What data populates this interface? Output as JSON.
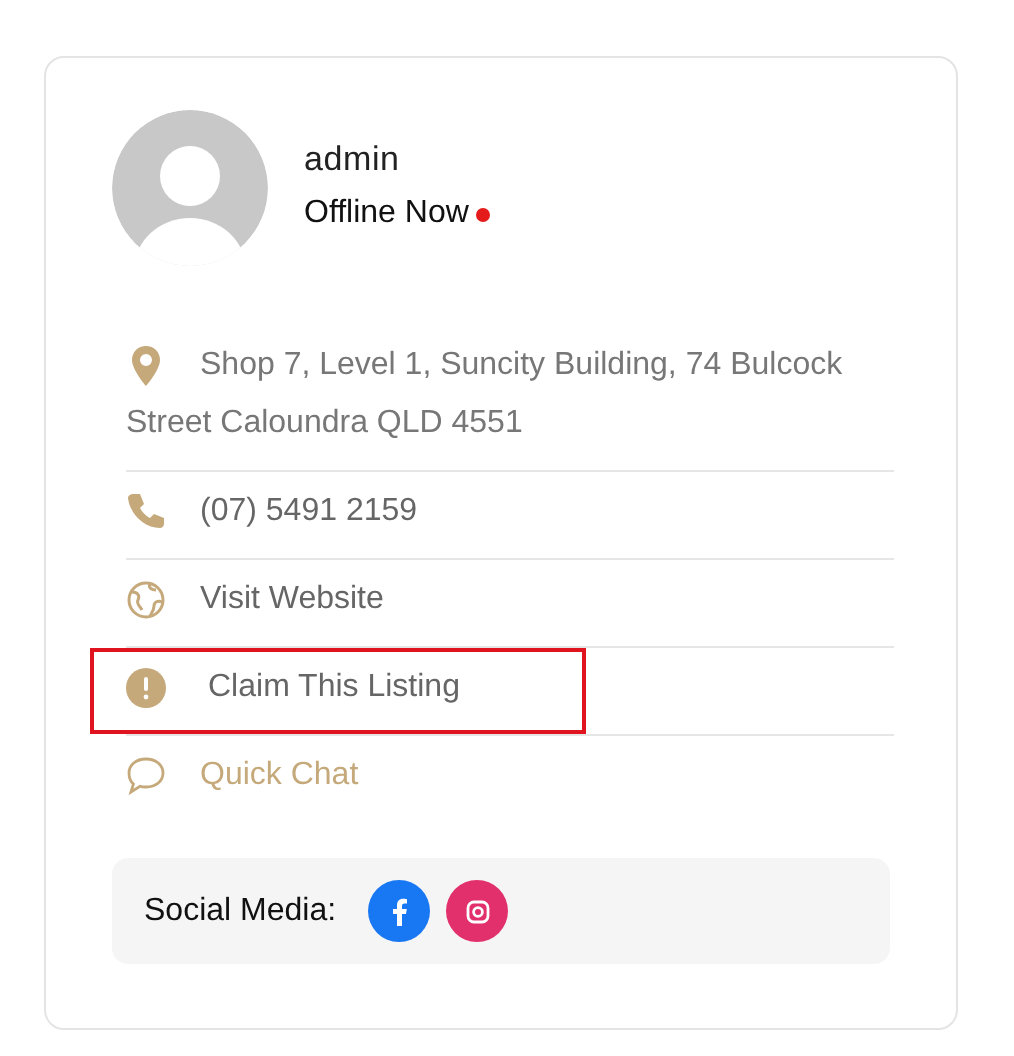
{
  "profile": {
    "name": "admin",
    "status": "Offline Now",
    "online": false
  },
  "contacts": [
    {
      "kind": "location",
      "lines": [
        "Shop 7, Level 1, Suncity Building, 74 Bulcock",
        "Street Caloundra QLD 4551"
      ],
      "highlighted": false
    },
    {
      "kind": "phone",
      "text": "(07) 5491 2159",
      "highlighted": false
    },
    {
      "kind": "website",
      "text": "Visit Website",
      "highlighted": false
    },
    {
      "kind": "claim",
      "text": "Claim This Listing",
      "highlighted": true
    },
    {
      "kind": "chat",
      "text": "Quick Chat",
      "highlighted": false
    }
  ],
  "social": {
    "label": "Social Media:",
    "links": [
      {
        "kind": "facebook"
      },
      {
        "kind": "instagram"
      }
    ]
  }
}
